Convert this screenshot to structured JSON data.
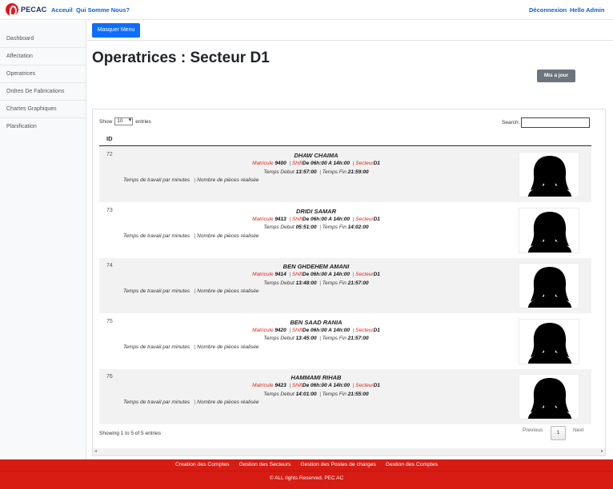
{
  "brand": {
    "name": "PECAC"
  },
  "nav": {
    "home": "Acceuil",
    "about": "Qui Somme Nous?",
    "logout": "Déconnexion",
    "hello": "Hello Admin"
  },
  "sidebar": {
    "items": [
      {
        "label": "Dashboard"
      },
      {
        "label": "Affectation"
      },
      {
        "label": "Operatrices"
      },
      {
        "label": "Ordres De Fabrications"
      },
      {
        "label": "Chartes Graphiques"
      },
      {
        "label": "Planification"
      }
    ]
  },
  "toolbar": {
    "toggle_menu": "Masquer Menu",
    "update": "Mis a jour"
  },
  "page": {
    "title": "Operatrices : Secteur D1"
  },
  "table": {
    "show_label": "Show",
    "entries_value": "10",
    "entries_label": "entries",
    "search_label": "Search:",
    "search_value": "",
    "col_id": "ID",
    "labels": {
      "matricule": "Matricule",
      "shift": "Shift",
      "secteur": "Secteur",
      "temps_debut": "Temps Debut",
      "temps_fin": "Temps Fin",
      "travail": "Temps de travail par minutes",
      "pieces": "Nombre de pièces réalisée"
    },
    "rows": [
      {
        "id": "72",
        "name": "DHAW CHAIMA",
        "matricule": "9400",
        "shift": "De 06h:00 A 14h:00",
        "secteur": "D1",
        "debut": "13:57:00",
        "fin": "21:59:00"
      },
      {
        "id": "73",
        "name": "DRIDI SAMAR",
        "matricule": "9413",
        "shift": "De 06h:00 A 14h:00",
        "secteur": "D1",
        "debut": "05:51:00",
        "fin": "14:02:00"
      },
      {
        "id": "74",
        "name": "BEN GHDEHEM AMANI",
        "matricule": "9414",
        "shift": "De 06h:00 A 14h:00",
        "secteur": "D1",
        "debut": "13:48:00",
        "fin": "21:57:00"
      },
      {
        "id": "75",
        "name": "BEN SAAD RANIA",
        "matricule": "9420",
        "shift": "De 06h:00 A 14h:00",
        "secteur": "D1",
        "debut": "13:45:00",
        "fin": "21:57:00"
      },
      {
        "id": "76",
        "name": "HAMMAMI RIHAB",
        "matricule": "9423",
        "shift": "De 06h:00 A 14h:00",
        "secteur": "D1",
        "debut": "14:01:00",
        "fin": "21:55:00"
      }
    ],
    "info": "Showing 1 to 5 of 5 entries",
    "previous": "Previous",
    "current_page": "1",
    "next": "Next"
  },
  "footer": {
    "links": [
      "Creation des Comptes",
      "Gestion des Secteurs",
      "Gestion des Postes de charges",
      "Gestion des Comptes"
    ],
    "copyright": "© ALL rights Reserved. PEC AC"
  },
  "icons": {
    "logo": "pecac-logo-icon",
    "avatar": "female-avatar-icon"
  },
  "colors": {
    "brand_red": "#d61c13",
    "primary": "#0d6efd",
    "secondary": "#6c757d",
    "link": "#0d5fd1"
  }
}
